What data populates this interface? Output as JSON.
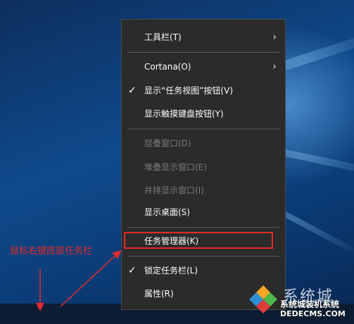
{
  "annotation": {
    "text": "鼠标右键底部任务栏"
  },
  "context_menu": {
    "items": [
      {
        "label": "工具栏(T)",
        "checked": false,
        "disabled": false,
        "submenu": true
      },
      {
        "label": "Cortana(O)",
        "checked": false,
        "disabled": false,
        "submenu": true
      },
      {
        "label": "显示“任务视图”按钮(V)",
        "checked": true,
        "disabled": false,
        "submenu": false
      },
      {
        "label": "显示触摸键盘按钮(Y)",
        "checked": false,
        "disabled": false,
        "submenu": false
      },
      {
        "label": "层叠窗口(D)",
        "checked": false,
        "disabled": true,
        "submenu": false
      },
      {
        "label": "堆叠显示窗口(E)",
        "checked": false,
        "disabled": true,
        "submenu": false
      },
      {
        "label": "并排显示窗口(I)",
        "checked": false,
        "disabled": true,
        "submenu": false
      },
      {
        "label": "显示桌面(S)",
        "checked": false,
        "disabled": false,
        "submenu": false
      },
      {
        "label": "任务管理器(K)",
        "checked": false,
        "disabled": false,
        "submenu": false,
        "highlighted": true
      },
      {
        "label": "锁定任务栏(L)",
        "checked": true,
        "disabled": false,
        "submenu": false
      },
      {
        "label": "属性(R)",
        "checked": false,
        "disabled": false,
        "submenu": false
      }
    ],
    "check_glyph": "✓",
    "chevron_glyph": "›"
  },
  "watermark": {
    "big_text": "系统城",
    "small_text": "系统城装机系统",
    "url": "DEDECMS.COM"
  },
  "colors": {
    "menu_bg": "#2b2b2b",
    "annotation_red": "#e32a2a",
    "disabled_text": "#7a7a7a"
  }
}
